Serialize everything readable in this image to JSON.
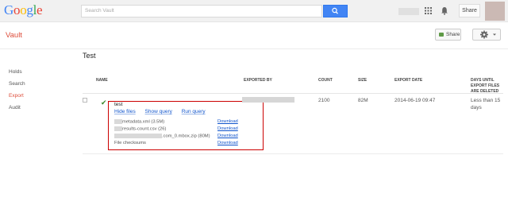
{
  "topbar": {
    "logo": [
      {
        "ch": "G",
        "color": "#4285f4"
      },
      {
        "ch": "o",
        "color": "#ea4335"
      },
      {
        "ch": "o",
        "color": "#fbbc05"
      },
      {
        "ch": "g",
        "color": "#4285f4"
      },
      {
        "ch": "l",
        "color": "#34a853"
      },
      {
        "ch": "e",
        "color": "#ea4335"
      }
    ],
    "search_placeholder": "Search Vault",
    "share_label": "Share"
  },
  "app": {
    "title": "Vault",
    "share_label": "Share"
  },
  "nav": {
    "items": [
      "Holds",
      "Search",
      "Export",
      "Audit"
    ],
    "active": "Export"
  },
  "page": {
    "title": "Test"
  },
  "table": {
    "headers": {
      "name": "NAME",
      "exported_by": "EXPORTED BY",
      "count": "COUNT",
      "size": "SIZE",
      "export_date": "EXPORT DATE",
      "days_until": [
        "DAYS UNTIL",
        "EXPORT FILES",
        "ARE DELETED"
      ]
    },
    "row": {
      "name": "test",
      "actions": [
        "Hide files",
        "Show query",
        "Run query"
      ],
      "files": [
        {
          "name": "metadata.xml (3.5M)",
          "action": "Download"
        },
        {
          "name": "results-count.csv (26)",
          "action": "Download"
        },
        {
          "name": ".com_0.mbox.zip (80M)",
          "action": "Download"
        },
        {
          "name": "File checksums",
          "action": "Download"
        }
      ],
      "count": "2100",
      "size": "82M",
      "export_date": "2014-06-19 09:47",
      "days_until": [
        "Less than 15",
        "days"
      ]
    }
  },
  "colors": {
    "brand_red": "#dd4b39",
    "link_blue": "#1155cc",
    "search_blue": "#4285f4",
    "highlight_box": "#cc0000"
  }
}
